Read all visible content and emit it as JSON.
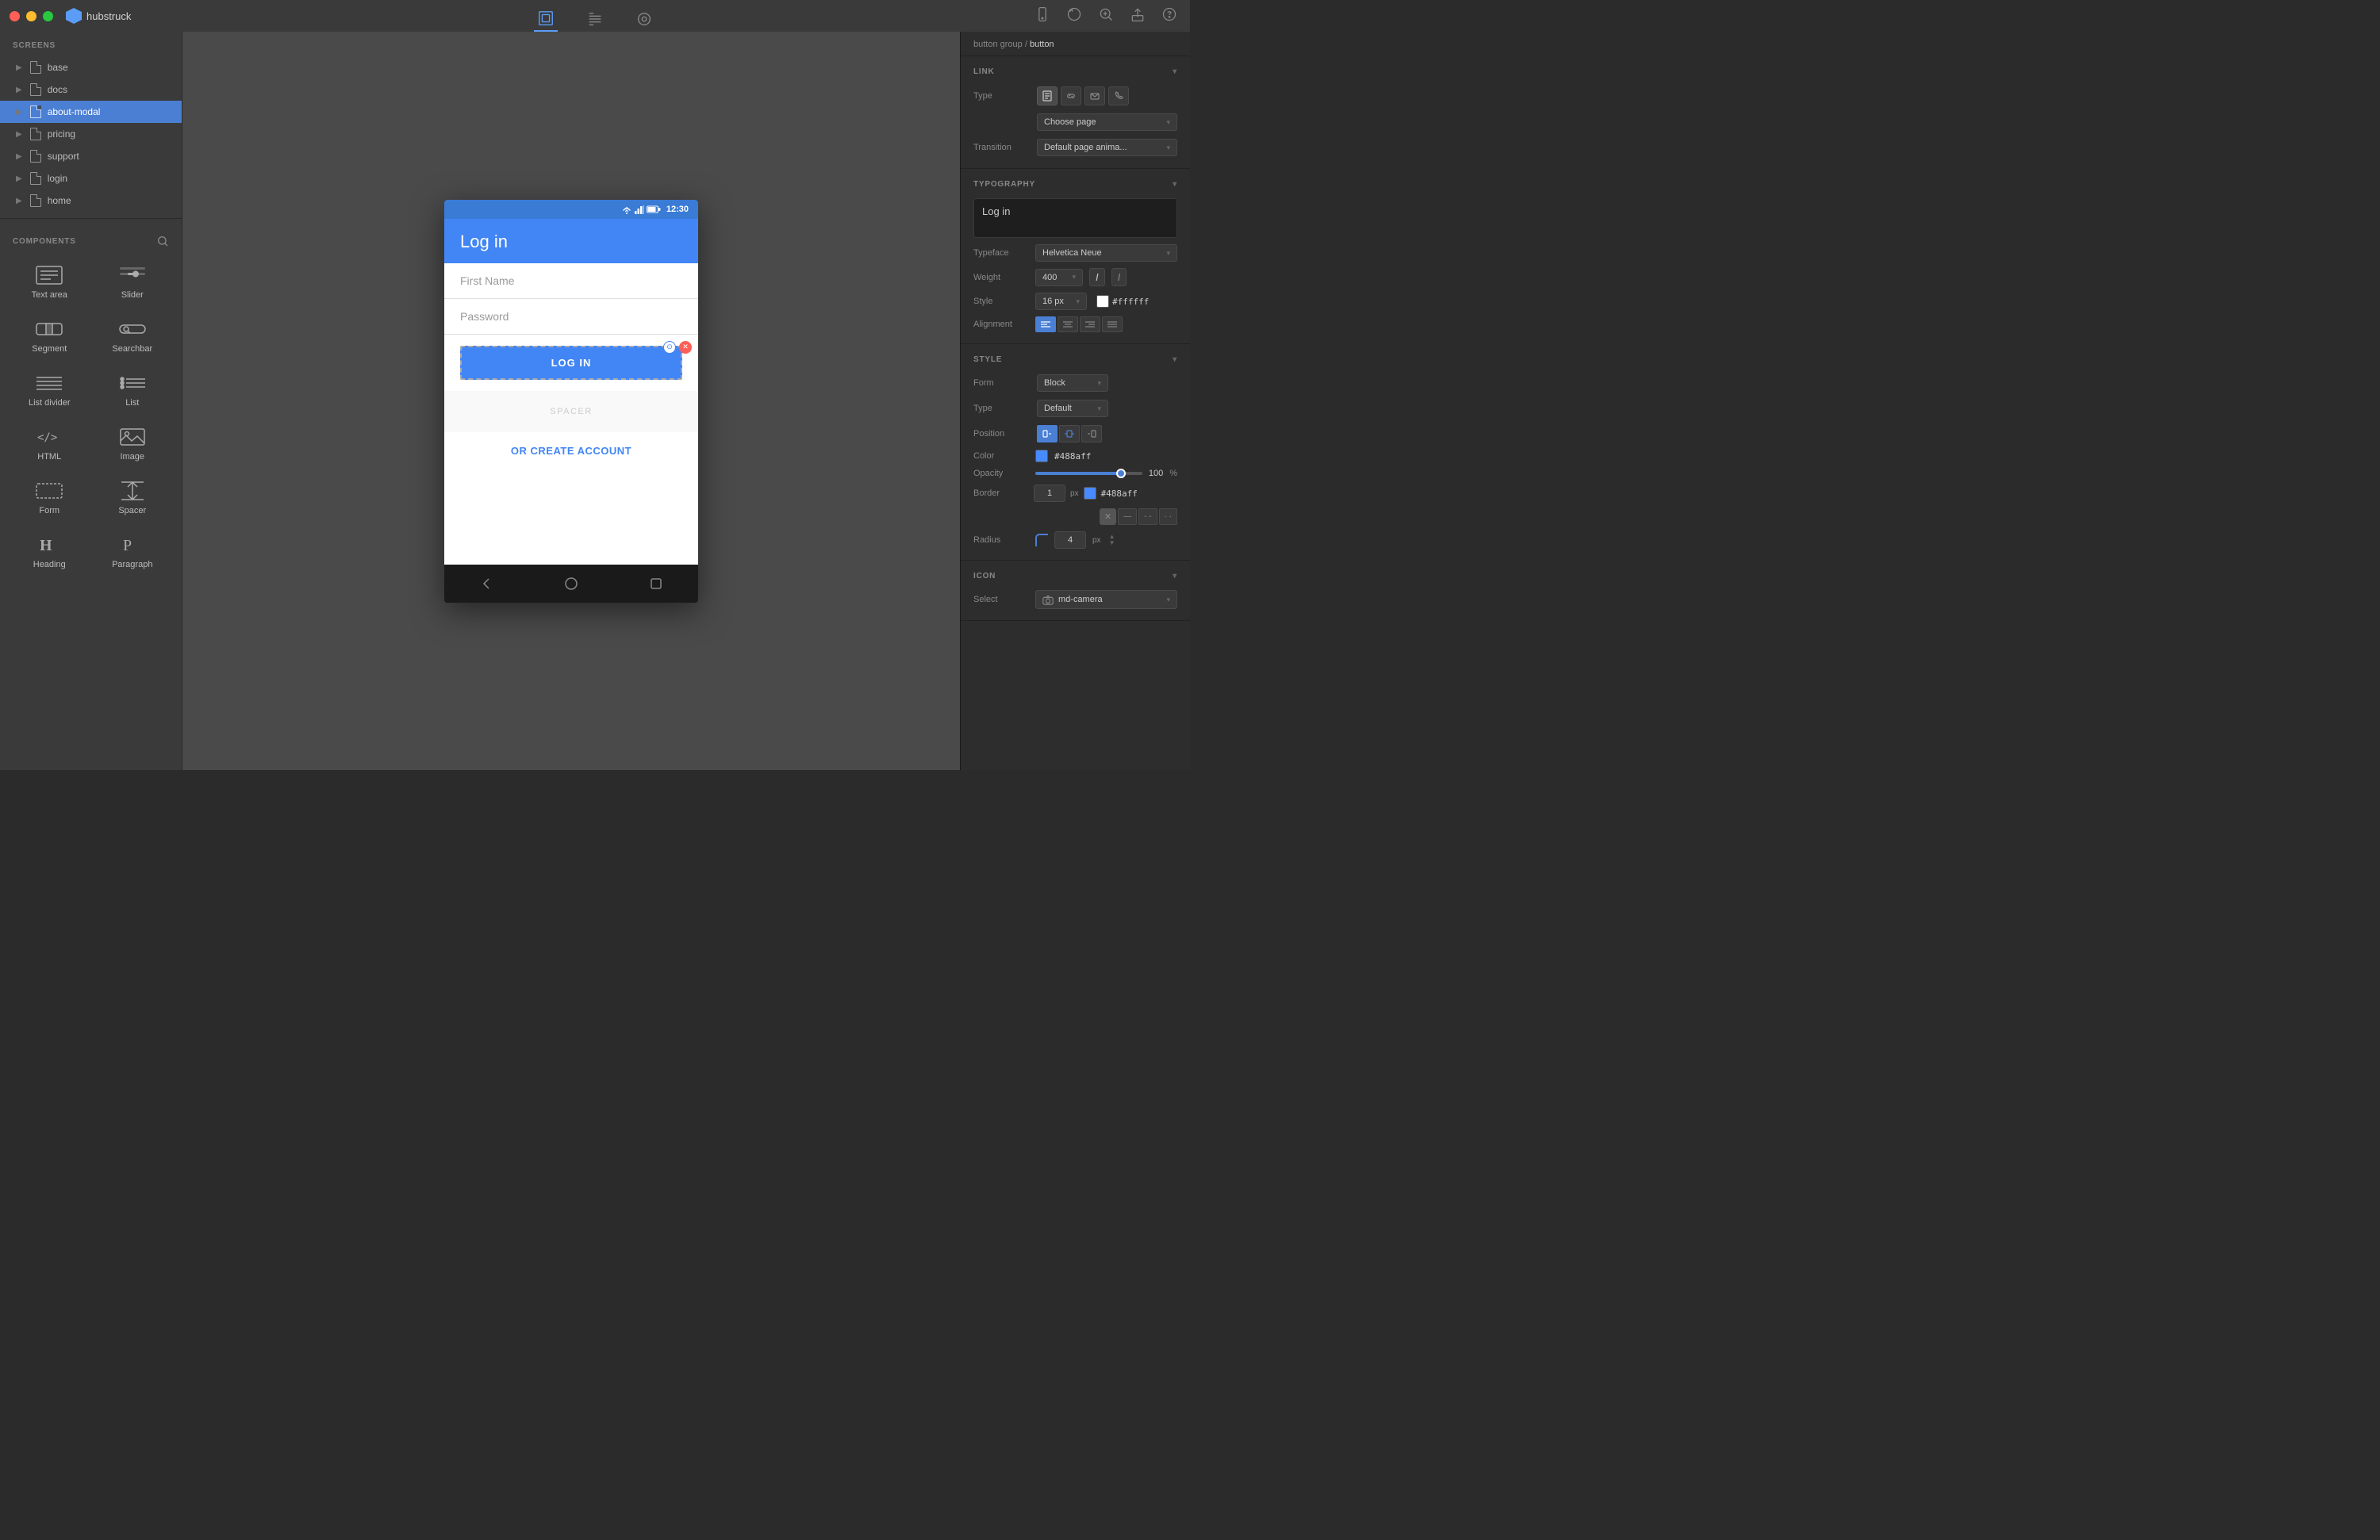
{
  "app": {
    "name": "hubstruck",
    "window": {
      "traffic_lights": [
        "close",
        "minimize",
        "maximize"
      ]
    }
  },
  "toolbar": {
    "items": [
      {
        "id": "design",
        "icon": "design-icon",
        "active": true
      },
      {
        "id": "layers",
        "icon": "layers-icon",
        "active": false
      },
      {
        "id": "preview",
        "icon": "preview-icon",
        "active": false
      }
    ],
    "right_items": [
      {
        "id": "mobile",
        "icon": "mobile-icon"
      },
      {
        "id": "undo",
        "icon": "undo-icon"
      },
      {
        "id": "zoom",
        "icon": "zoom-icon"
      },
      {
        "id": "share",
        "icon": "share-icon"
      },
      {
        "id": "help",
        "icon": "help-icon"
      }
    ]
  },
  "sidebar": {
    "screens_title": "SCREENS",
    "items": [
      {
        "id": "base",
        "label": "base",
        "active": false
      },
      {
        "id": "docs",
        "label": "docs",
        "active": false
      },
      {
        "id": "about-modal",
        "label": "about-modal",
        "active": true
      },
      {
        "id": "pricing",
        "label": "pricing",
        "active": false
      },
      {
        "id": "support",
        "label": "support",
        "active": false
      },
      {
        "id": "login",
        "label": "login",
        "active": false
      },
      {
        "id": "home",
        "label": "home",
        "active": false
      }
    ],
    "components_title": "COMPONENTS",
    "components": [
      {
        "id": "text-area",
        "label": "Text area",
        "icon": "textarea-icon"
      },
      {
        "id": "slider",
        "label": "Slider",
        "icon": "slider-icon"
      },
      {
        "id": "segment",
        "label": "Segment",
        "icon": "segment-icon"
      },
      {
        "id": "searchbar",
        "label": "Searchbar",
        "icon": "searchbar-icon"
      },
      {
        "id": "list-divider",
        "label": "List divider",
        "icon": "listdivider-icon"
      },
      {
        "id": "list",
        "label": "List",
        "icon": "list-icon"
      },
      {
        "id": "html",
        "label": "HTML",
        "icon": "html-icon"
      },
      {
        "id": "image",
        "label": "Image",
        "icon": "image-icon"
      },
      {
        "id": "form",
        "label": "Form",
        "icon": "form-icon"
      },
      {
        "id": "spacer",
        "label": "Spacer",
        "icon": "spacer-icon"
      },
      {
        "id": "heading",
        "label": "Heading",
        "icon": "heading-icon"
      },
      {
        "id": "paragraph",
        "label": "Paragraph",
        "icon": "paragraph-icon"
      }
    ]
  },
  "canvas": {
    "phone": {
      "status_bar": {
        "time": "12:30"
      },
      "header": {
        "title": "Log in"
      },
      "fields": [
        {
          "placeholder": "First Name"
        },
        {
          "placeholder": "Password"
        }
      ],
      "button": {
        "label": "LOG IN",
        "color": "#4285f4"
      },
      "spacer": {
        "label": "SPACER"
      },
      "link": {
        "label": "OR CREATE ACCOUNT",
        "color": "#4285f4"
      }
    }
  },
  "right_panel": {
    "breadcrumb": {
      "parent": "button group",
      "current": "button"
    },
    "link_section": {
      "title": "LINK",
      "type_label": "Type",
      "type_icons": [
        "page-icon",
        "link-icon",
        "email-icon",
        "phone-icon"
      ],
      "page_select": "Choose page",
      "transition_label": "Transition",
      "transition_value": "Default page anima..."
    },
    "typography_section": {
      "title": "TYPOGRAPHY",
      "text_value": "Log in",
      "typeface_label": "Typeface",
      "typeface_value": "Helvetica Neue",
      "weight_label": "Weight",
      "weight_value": "400",
      "style_label": "Style",
      "size_value": "16 px",
      "color_value": "#ffffff",
      "alignment_label": "Alignment",
      "alignment_options": [
        "left",
        "center",
        "right",
        "justify"
      ]
    },
    "style_section": {
      "title": "STYLE",
      "form_label": "Form",
      "form_value": "Block",
      "type_label": "Type",
      "type_value": "Default",
      "position_label": "Position",
      "position_options": [
        "left",
        "center",
        "right"
      ],
      "color_label": "Color",
      "color_value": "#488aff",
      "opacity_label": "Opacity",
      "opacity_value": "100",
      "opacity_unit": "%",
      "border_label": "Border",
      "border_size": "1",
      "border_unit": "px",
      "border_color": "#488aff",
      "radius_label": "Radius",
      "radius_value": "4",
      "radius_unit": "px"
    },
    "icon_section": {
      "title": "ICON",
      "select_label": "Select",
      "select_value": "md-camera"
    }
  }
}
